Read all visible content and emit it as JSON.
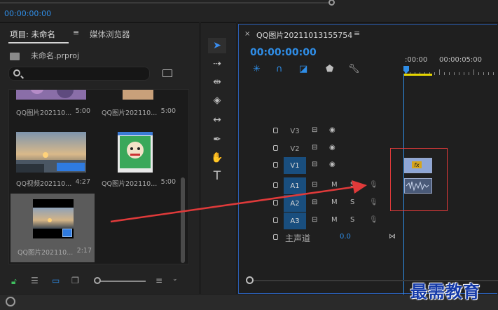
{
  "source_monitor": {
    "timecode": "00:00:00:00"
  },
  "project": {
    "tab_label": "项目: 未命名",
    "tab_menu": "≡",
    "media_tab": "媒体浏览器",
    "file_name": "未命名.prproj",
    "clips": [
      {
        "name": "QQ图片202110...",
        "duration": "5:00"
      },
      {
        "name": "QQ图片202110...",
        "duration": "5:00"
      },
      {
        "name": "QQ视频202110...",
        "duration": "4:27"
      },
      {
        "name": "QQ图片202110...",
        "duration": "5:00"
      },
      {
        "name": "QQ图片202110...",
        "duration": "2:17"
      }
    ]
  },
  "timeline": {
    "close": "×",
    "title": "QQ图片20211013155754",
    "menu": "≡",
    "timecode": "00:00:00:00",
    "ruler": [
      ":00:00",
      "00:00:05:00"
    ],
    "tracks": [
      {
        "name": "V3",
        "type": "video"
      },
      {
        "name": "V2",
        "type": "video"
      },
      {
        "name": "V1",
        "type": "video",
        "target": true
      },
      {
        "name": "A1",
        "type": "audio",
        "target": true
      },
      {
        "name": "A2",
        "type": "audio",
        "target": true
      },
      {
        "name": "A3",
        "type": "audio",
        "target": true
      }
    ],
    "master": {
      "label": "主声道",
      "value": "0.0"
    },
    "m_label": "M",
    "s_label": "S",
    "fx": "fx"
  },
  "watermark": "最需教育",
  "colors": {
    "accent": "#2f8ee8",
    "annotation": "#e03a3a",
    "workarea": "#e6d600"
  }
}
